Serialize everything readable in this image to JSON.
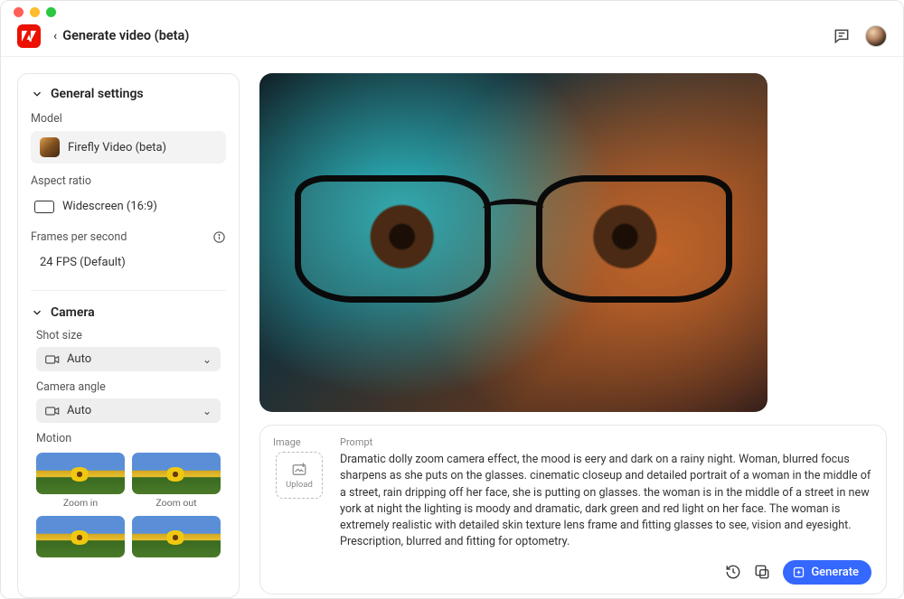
{
  "header": {
    "page_title": "Generate video (beta)"
  },
  "sidebar": {
    "general": {
      "title": "General settings",
      "model_label": "Model",
      "model_value": "Firefly Video (beta)",
      "aspect_label": "Aspect ratio",
      "aspect_value": "Widescreen (16:9)",
      "fps_label": "Frames per second",
      "fps_value": "24 FPS (Default)"
    },
    "camera": {
      "title": "Camera",
      "shot_label": "Shot size",
      "shot_value": "Auto",
      "angle_label": "Camera angle",
      "angle_value": "Auto",
      "motion_label": "Motion",
      "motion_tiles": [
        "Zoom in",
        "Zoom out",
        "",
        ""
      ]
    }
  },
  "prompt_panel": {
    "image_label": "Image",
    "upload_label": "Upload",
    "prompt_label": "Prompt",
    "prompt_text": "Dramatic dolly zoom camera effect, the mood is eery and dark on a rainy night. Woman, blurred focus sharpens as she puts on the glasses. cinematic closeup and detailed portrait of a woman in the middle of a street, rain dripping off her face, she is putting on glasses. the woman is in the middle of a street in new york at night the lighting is moody and dramatic, dark green and red light on her face. The woman is extremely realistic with detailed skin texture lens frame and fitting glasses to see, vision and eyesight. Prescription, blurred and fitting for optometry.",
    "generate_label": "Generate"
  }
}
